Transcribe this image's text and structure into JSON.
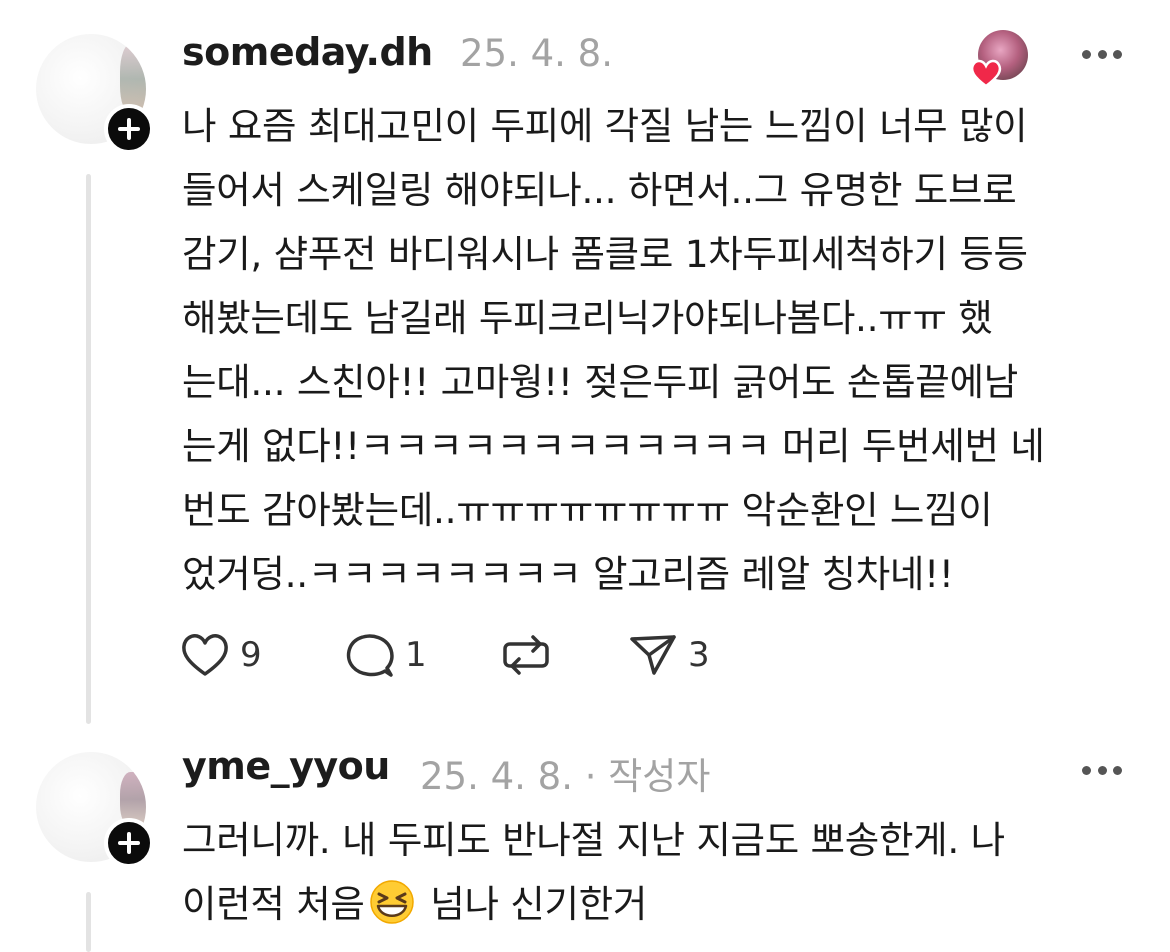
{
  "comments": [
    {
      "username": "someday.dh",
      "date": "25. 4. 8.",
      "author_tag": "",
      "lines": [
        "나 요즘 최대고민이 두피에 각질 남는 느낌이 너무 많이",
        "들어서 스케일링 해야되나... 하면서..그 유명한 도브로",
        "감기, 샴푸전 바디워시나 폼클로 1차두피세척하기 등등",
        "해봤는데도 남길래 두피크리닉가야되나봄다..ㅠㅠ 했",
        "는대... 스친아!! 고마웡!! 젖은두피 긁어도 손톱끝에남",
        "는게 없다!!ㅋㅋㅋㅋㅋㅋㅋㅋㅋㅋㅋㅋ 머리 두번세번 네",
        "번도 감아봤는데..ㅠㅠㅠㅠㅠㅠㅠㅠ 악순환인 느낌이",
        "었거덩..ㅋㅋㅋㅋㅋㅋㅋㅋ  알고리즘 레알 칭차네!!"
      ],
      "likes": "9",
      "replies": "1",
      "shares": "3"
    },
    {
      "username": "yme_yyou",
      "date": "25. 4. 8.",
      "author_tag": " · 작성자",
      "lines": [
        "그러니까. 내 두피도 반나절 지난 지금도 뽀송한게. 나",
        "이런적 처음"
      ],
      "line2_tail": " 넘나 신기한거",
      "emoji": "grinning-squinting-face"
    }
  ],
  "icons": {
    "like": "heart-outline-icon",
    "reply": "speech-bubble-icon",
    "repost": "repost-arrows-icon",
    "share": "paper-plane-icon",
    "more": "more-dots-icon",
    "follow": "plus-badge-icon"
  },
  "colors": {
    "heart_red": "#f02849",
    "meta_gray": "#a3a3a3",
    "thread_line": "#e3e3e3"
  }
}
